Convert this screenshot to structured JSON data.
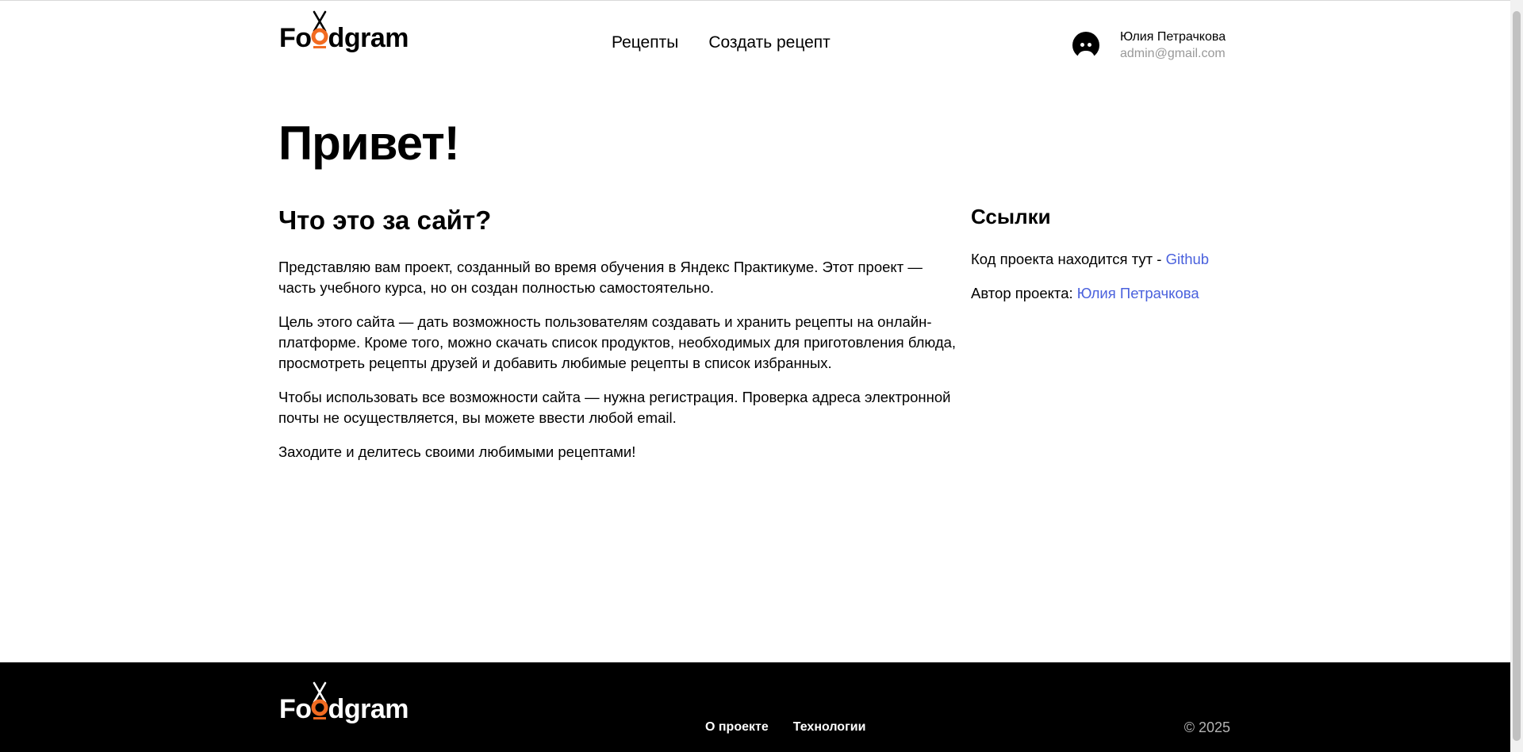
{
  "header": {
    "logo": {
      "before": "Fo",
      "after": "dgram"
    },
    "nav": [
      "Рецепты",
      "Создать рецепт"
    ],
    "user": {
      "name": "Юлия Петрачкова",
      "email": "admin@gmail.com"
    }
  },
  "main": {
    "title": "Привет!",
    "about": {
      "heading": "Что это за сайт?",
      "paragraphs": [
        "Представляю вам проект, созданный во время обучения в Яндекс Практикуме. Этот проект — часть учебного курса, но он создан полностью самостоятельно.",
        "Цель этого сайта — дать возможность пользователям создавать и хранить рецепты на онлайн-платформе. Кроме того, можно скачать список продуктов, необходимых для приготовления блюда, просмотреть рецепты друзей и добавить любимые рецепты в список избранных.",
        "Чтобы использовать все возможности сайта — нужна регистрация. Проверка адреса электронной почты не осуществляется, вы можете ввести любой email.",
        "Заходите и делитесь своими любимыми рецептами!"
      ]
    },
    "links": {
      "heading": "Ссылки",
      "code_text": "Код проекта находится тут - ",
      "code_link": "Github",
      "author_text": "Автор проекта: ",
      "author_link": "Юлия Петрачкова"
    }
  },
  "footer": {
    "logo": {
      "before": "Fo",
      "after": "dgram"
    },
    "nav": [
      "О проекте",
      "Технологии"
    ],
    "copyright": "© 2025"
  },
  "colors": {
    "accent_orange": "#f26b21",
    "link_blue": "#4a61dd",
    "footer_bg": "#000000"
  },
  "icons": {
    "logo_mark": "chopsticks-bowl-icon",
    "avatar": "user-avatar-icon"
  }
}
